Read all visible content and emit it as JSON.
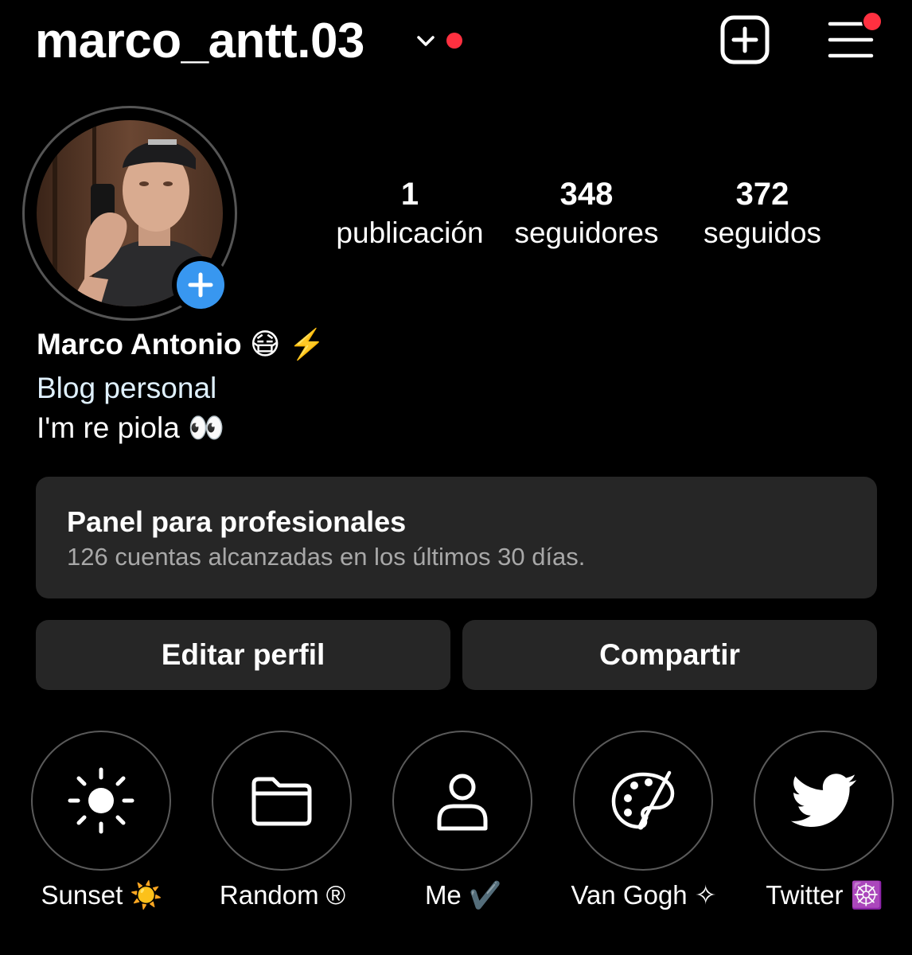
{
  "header": {
    "username": "marco_antt.03",
    "notification_color": "#ff3040"
  },
  "profile": {
    "display_name": "Marco Antonio 😷 ⚡️",
    "category": "Blog personal",
    "bio": "I'm re piola 👀",
    "category_color": "#e0f1ff"
  },
  "stats": [
    {
      "value": "1",
      "label": "publicación"
    },
    {
      "value": "348",
      "label": "seguidores"
    },
    {
      "value": "372",
      "label": "seguidos"
    }
  ],
  "dashboard": {
    "title": "Panel para profesionales",
    "subtitle": "126 cuentas alcanzadas en los últimos 30 días."
  },
  "actions": {
    "edit_label": "Editar perfil",
    "share_label": "Compartir"
  },
  "highlights": [
    {
      "label": "Sunset ☀️",
      "icon": "sun-icon"
    },
    {
      "label": "Random ®",
      "icon": "folder-icon"
    },
    {
      "label": "Me ✔️",
      "icon": "person-icon"
    },
    {
      "label": "Van Gogh ✧",
      "icon": "palette-icon"
    },
    {
      "label": "Twitter ☸️",
      "icon": "twitter-bird-icon"
    }
  ]
}
